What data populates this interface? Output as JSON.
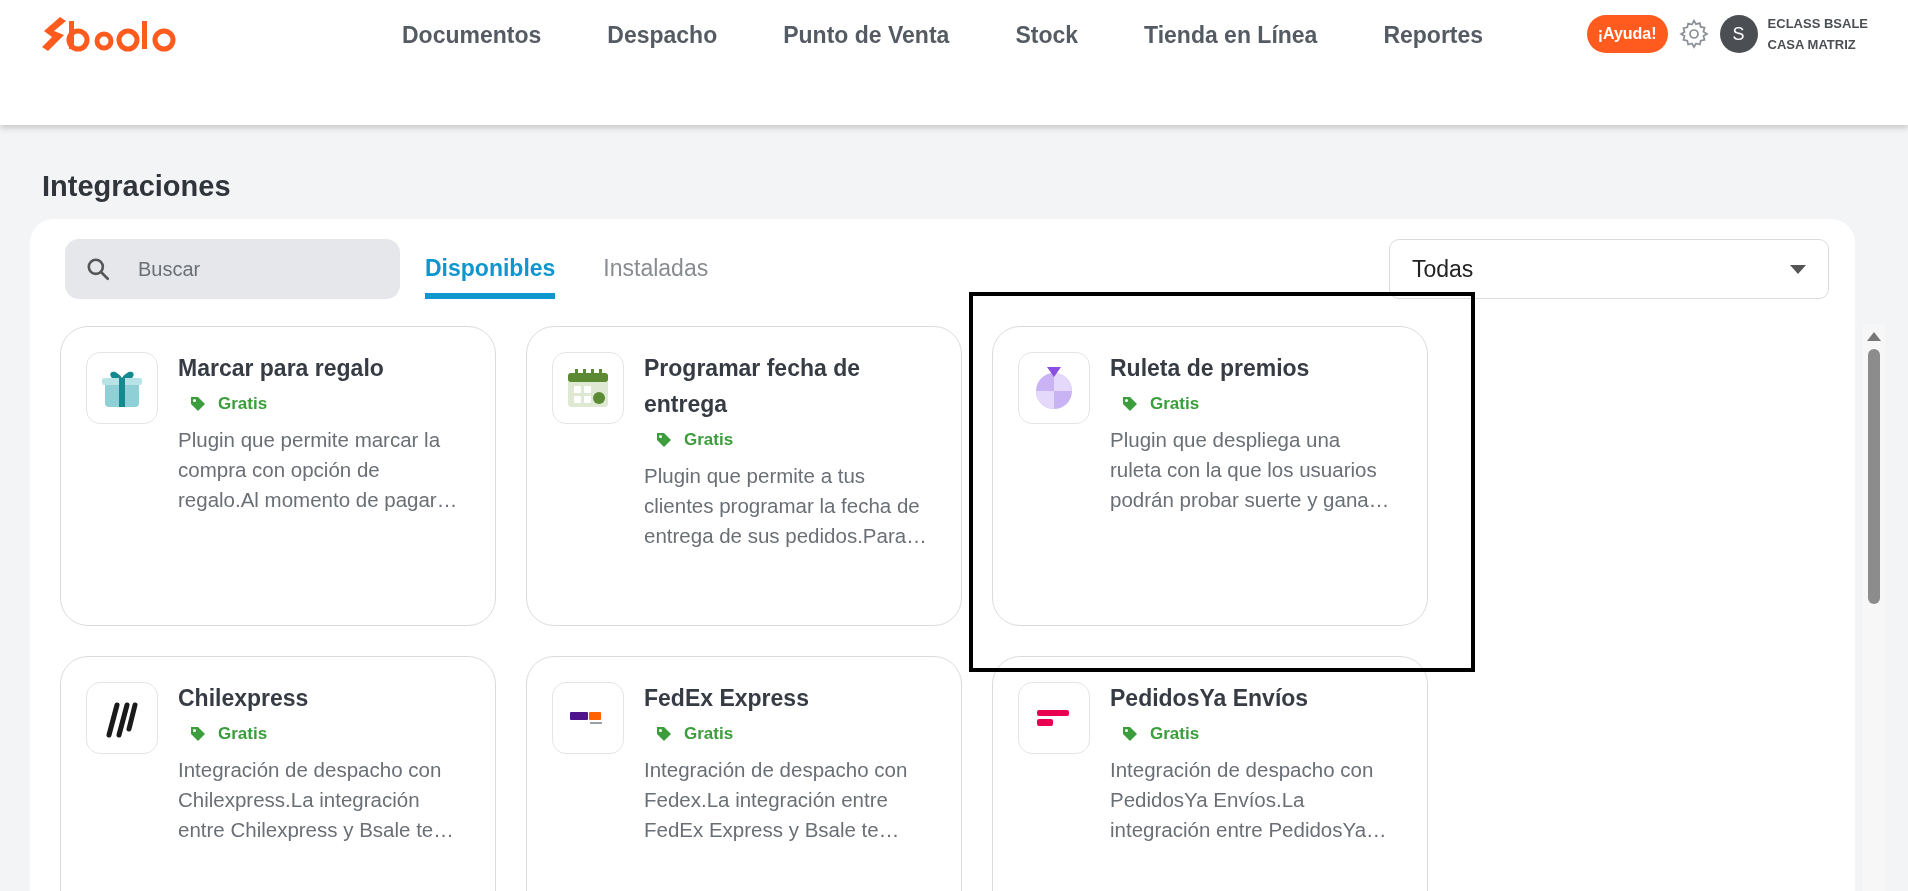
{
  "header": {
    "nav": [
      "Documentos",
      "Despacho",
      "Punto de Venta",
      "Stock",
      "Tienda en Línea",
      "Reportes"
    ],
    "help_button": "¡Ayuda!",
    "user": {
      "avatar": "S",
      "company": "ECLASS BSALE",
      "branch": "CASA MATRIZ"
    }
  },
  "page_title": "Integraciones",
  "search": {
    "placeholder": "Buscar"
  },
  "tabs": [
    {
      "label": "Disponibles",
      "selected": true
    },
    {
      "label": "Instaladas",
      "selected": false
    }
  ],
  "filter": {
    "value": "Todas"
  },
  "cards": [
    {
      "title": "Marcar para regalo",
      "price": "Gratis",
      "description": "Plugin que permite marcar la compra con opción de regalo.Al momento de pagar…"
    },
    {
      "title": "Programar fecha de entrega",
      "price": "Gratis",
      "description": "Plugin que permite a tus clientes programar la fecha de entrega de sus pedidos.Para…"
    },
    {
      "title": "Ruleta de premios",
      "price": "Gratis",
      "description": "Plugin que despliega una ruleta con la que los usuarios podrán probar suerte y gana…"
    },
    {
      "title": "Chilexpress",
      "price": "Gratis",
      "description": "Integración de despacho con Chilexpress.La integración entre Chilexpress y Bsale te…"
    },
    {
      "title": "FedEx Express",
      "price": "Gratis",
      "description": "Integración de despacho con Fedex.La integración entre FedEx Express y Bsale te…"
    },
    {
      "title": "PedidosYa Envíos",
      "price": "Gratis",
      "description": "Integración de despacho con PedidosYa Envíos.La integración entre PedidosYa…"
    }
  ]
}
